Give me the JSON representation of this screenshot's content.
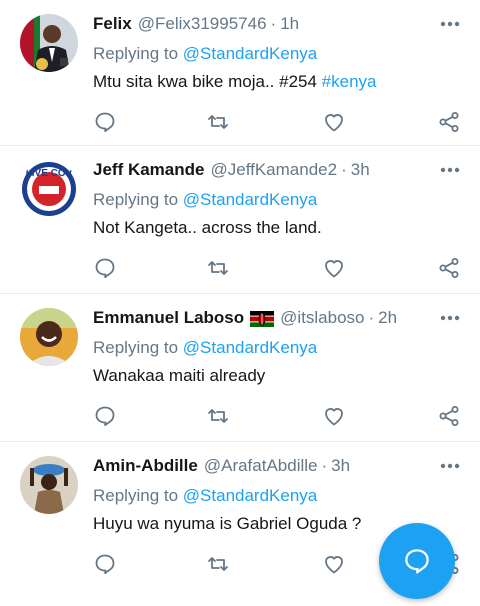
{
  "tweets": [
    {
      "name": "Felix",
      "handle": "@Felix31995746",
      "time": "1h",
      "replying_prefix": "Replying to",
      "replying_to": "@StandardKenya",
      "text_plain": "Mtu sita kwa bike moja.. #254 ",
      "text_tag": "#kenya",
      "avatar_icon": "presidential-portrait-avatar",
      "has_flag": false
    },
    {
      "name": "Jeff Kamande",
      "handle": "@JeffKamande2",
      "time": "3h",
      "replying_prefix": "Replying to",
      "replying_to": "@StandardKenya",
      "text_plain": "Not Kangeta.. across the land.",
      "text_tag": "",
      "avatar_icon": "live-coverage-logo-avatar",
      "avatar_text": "LIVE COV",
      "has_flag": false
    },
    {
      "name": "Emmanuel Laboso",
      "handle": "@itslaboso",
      "time": "2h",
      "replying_prefix": "Replying to",
      "replying_to": "@StandardKenya",
      "text_plain": "Wanakaa maiti already",
      "text_tag": "",
      "avatar_icon": "smiling-man-avatar",
      "has_flag": true
    },
    {
      "name": "Amin-Abdille",
      "handle": "@ArafatAbdille",
      "time": "3h",
      "replying_prefix": "Replying to",
      "replying_to": "@StandardKenya",
      "text_plain": "Huyu wa nyuma is Gabriel Oguda ?",
      "text_tag": "",
      "avatar_icon": "person-carrying-basin-avatar",
      "has_flag": false
    }
  ],
  "separator": "·",
  "colors": {
    "accent": "#1da1f2",
    "muted": "#657786",
    "text": "#14171a",
    "divider": "#e6ecf0"
  }
}
